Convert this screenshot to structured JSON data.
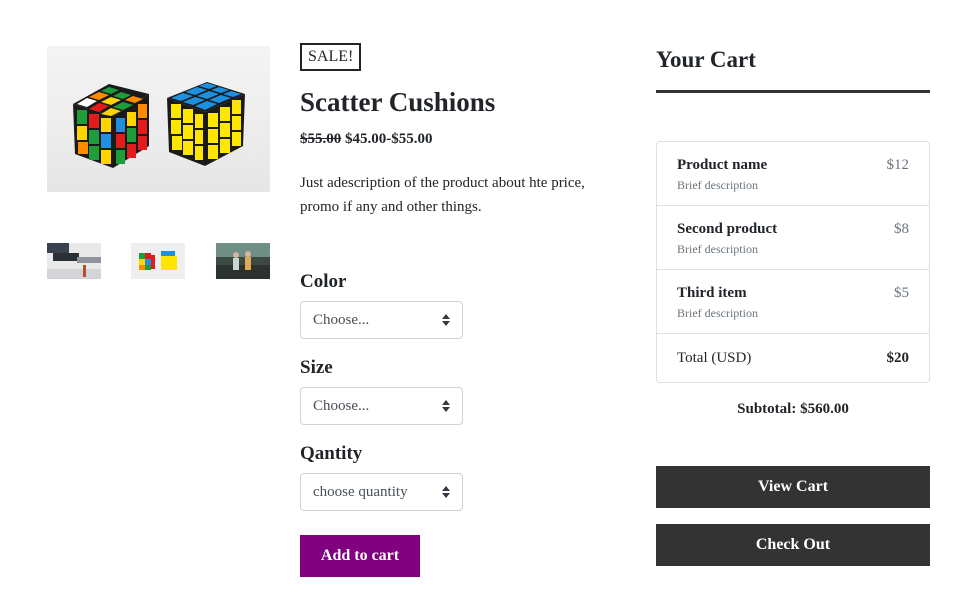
{
  "gallery": {
    "main_image": "rubiks-cubes-photo",
    "thumbnails": [
      "desk-photo",
      "rubiks-cubes-photo",
      "people-outdoors-photo"
    ]
  },
  "product": {
    "badge": "SALE!",
    "title": "Scatter Cushions",
    "old_price": "$55.00",
    "price_range": "$45.00-$55.00",
    "description": "Just adescription of the product about hte price, promo if any and other things."
  },
  "options": {
    "color_label": "Color",
    "color_value": "Choose...",
    "size_label": "Size",
    "size_value": "Choose...",
    "quantity_label": "Qantity",
    "quantity_value": "choose quantity"
  },
  "add_to_cart_label": "Add to cart",
  "cart": {
    "heading": "Your Cart",
    "items": [
      {
        "name": "Product name",
        "description": "Brief description",
        "price": "$12"
      },
      {
        "name": "Second product",
        "description": "Brief description",
        "price": "$8"
      },
      {
        "name": "Third item",
        "description": "Brief description",
        "price": "$5"
      }
    ],
    "total_label": "Total (USD)",
    "total_amount": "$20",
    "subtotal": "Subtotal: $560.00",
    "view_cart_label": "View Cart",
    "check_out_label": "Check Out"
  },
  "colors": {
    "accent_purple": "#800080",
    "button_dark": "#333333"
  }
}
